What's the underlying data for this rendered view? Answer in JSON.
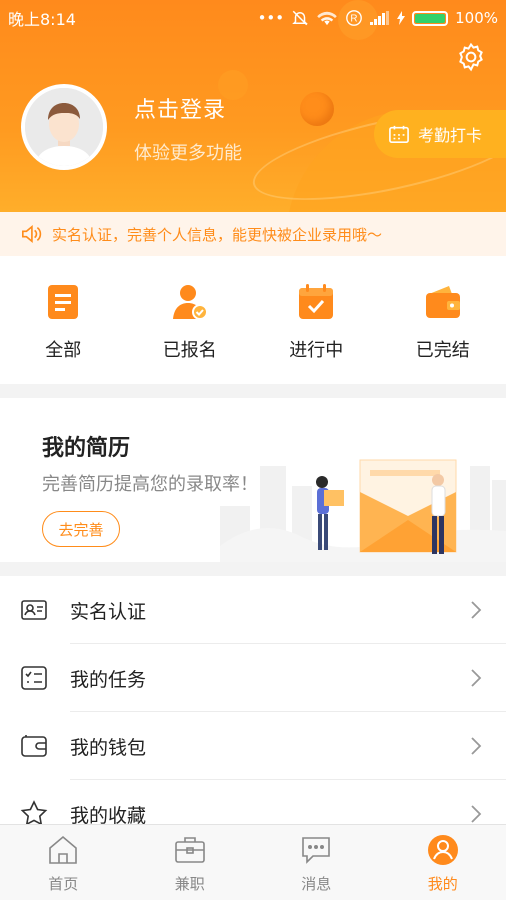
{
  "status_bar": {
    "time": "晚上8:14",
    "battery": "100%"
  },
  "header": {
    "login_title": "点击登录",
    "login_subtitle": "体验更多功能",
    "clockin_label": "考勤打卡"
  },
  "notice": {
    "text": "实名认证，完善个人信息，能更快被企业录用哦～"
  },
  "shortcuts": [
    {
      "label": "全部",
      "icon": "clipboard-icon"
    },
    {
      "label": "已报名",
      "icon": "user-check-icon"
    },
    {
      "label": "进行中",
      "icon": "calendar-check-icon"
    },
    {
      "label": "已完结",
      "icon": "wallet-icon"
    }
  ],
  "resume": {
    "title": "我的简历",
    "subtitle": "完善简历提高您的录取率！",
    "button_label": "去完善"
  },
  "menu": [
    {
      "label": "实名认证",
      "icon": "id-card-icon"
    },
    {
      "label": "我的任务",
      "icon": "task-list-icon"
    },
    {
      "label": "我的钱包",
      "icon": "wallet-icon"
    },
    {
      "label": "我的收藏",
      "icon": "star-icon"
    }
  ],
  "tabbar": [
    {
      "label": "首页",
      "icon": "home-icon",
      "active": false
    },
    {
      "label": "兼职",
      "icon": "briefcase-icon",
      "active": false
    },
    {
      "label": "消息",
      "icon": "chat-icon",
      "active": false
    },
    {
      "label": "我的",
      "icon": "profile-icon",
      "active": true
    }
  ],
  "colors": {
    "accent": "#ff8a1c",
    "accent_light": "#ffb11f",
    "notice_bg": "#fff4ea"
  }
}
